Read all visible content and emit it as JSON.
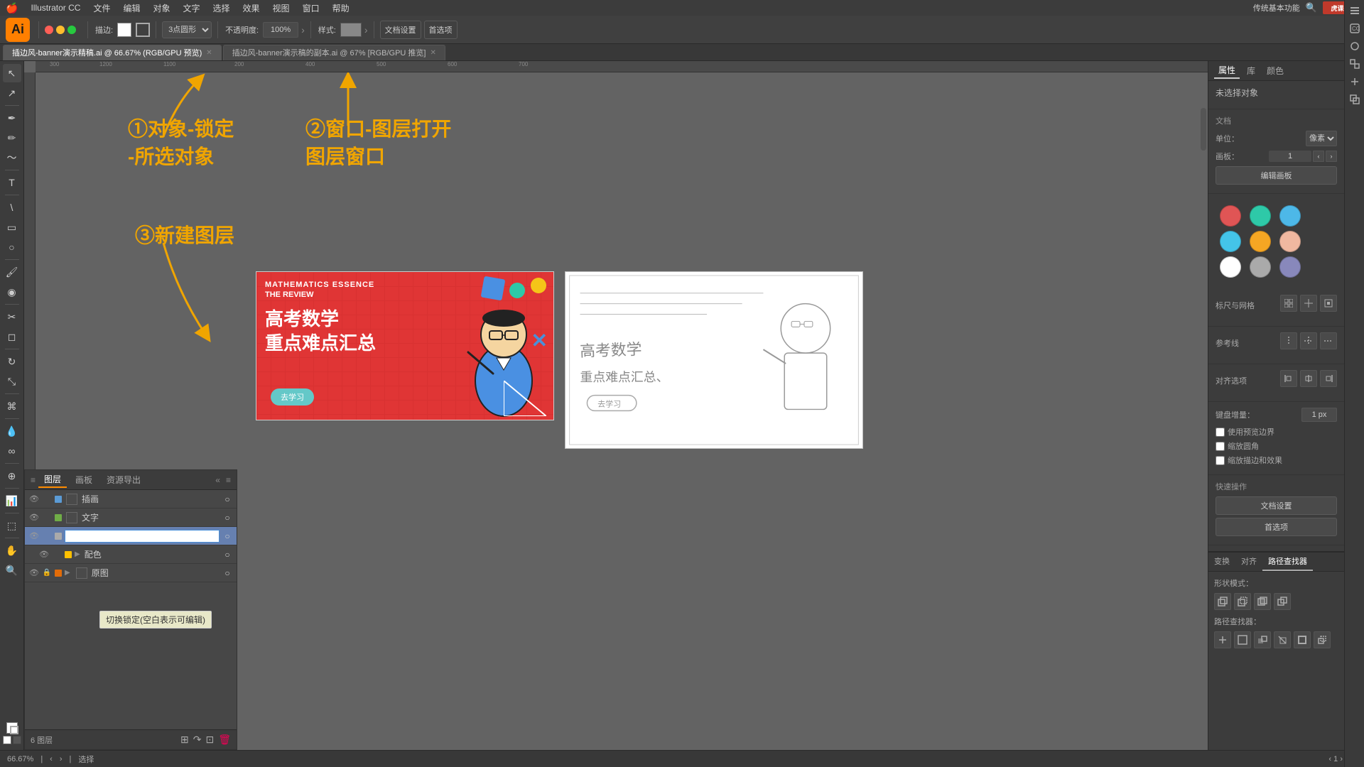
{
  "app": {
    "name": "Illustrator CC",
    "logo": "Ai",
    "version": "CC"
  },
  "menubar": {
    "apple": "🍎",
    "items": [
      "Illustrator CC",
      "文件",
      "编辑",
      "对象",
      "文字",
      "选择",
      "效果",
      "视图",
      "窗口",
      "帮助"
    ]
  },
  "toolbar": {
    "stroke_label": "描边:",
    "stroke_value": "",
    "shape_label": "3点圆形",
    "opacity_label": "不透明度:",
    "opacity_value": "100%",
    "style_label": "样式:",
    "doc_settings": "文档设置",
    "preferences": "首选项",
    "function_label": "传统基本功能"
  },
  "tabs": [
    {
      "name": "插边风-banner演示精稿.ai",
      "mode": "66.67%",
      "color": "RGB/GPU",
      "active": true
    },
    {
      "name": "插边风-banner演示稿的副本.ai",
      "mode": "67%",
      "color": "RGB/GPU 预览",
      "active": false
    }
  ],
  "annotations": {
    "step1": "①对象-锁定\n-所选对象",
    "step2": "②窗口-图层打开\n图层窗口",
    "step3": "③新建图层"
  },
  "layers_panel": {
    "title": "图层",
    "tabs": [
      "图层",
      "画板",
      "资源导出"
    ],
    "layers": [
      {
        "name": "插画",
        "color": "#5b9bd5",
        "visible": true,
        "locked": false,
        "expanded": false
      },
      {
        "name": "文字",
        "color": "#70ad47",
        "visible": true,
        "locked": false,
        "expanded": false
      },
      {
        "name": "",
        "color": "#aaaaaa",
        "visible": true,
        "locked": false,
        "expanded": false,
        "editing": true
      },
      {
        "name": "配色",
        "color": "#ffc000",
        "visible": true,
        "locked": false,
        "expanded": true,
        "indent": true
      },
      {
        "name": "原图",
        "color": "#e36c09",
        "visible": true,
        "locked": true,
        "expanded": false
      }
    ],
    "footer": "6 图层",
    "tooltip": "切换锁定(空白表示可编辑)"
  },
  "right_panel": {
    "tabs": [
      "属性",
      "库",
      "颜色"
    ],
    "active_tab": "属性",
    "selection": "未选择对象",
    "doc_section": "文档",
    "unit_label": "单位：",
    "unit_value": "像素",
    "artboard_label": "画板：",
    "artboard_value": "1",
    "edit_artboard_btn": "编辑画板",
    "swatches": [
      {
        "color": "#e05555",
        "name": "red"
      },
      {
        "color": "#2ec9a8",
        "name": "teal"
      },
      {
        "color": "#4db8e8",
        "name": "light-blue"
      },
      {
        "color": "#44c4e8",
        "name": "cyan"
      },
      {
        "color": "#f5a623",
        "name": "orange"
      },
      {
        "color": "#f0b8a0",
        "name": "salmon"
      },
      {
        "color": "#ffffff",
        "name": "white"
      },
      {
        "color": "#aaaaaa",
        "name": "gray"
      },
      {
        "color": "#8888bb",
        "name": "lavender"
      }
    ],
    "snap_label": "标尺与网格",
    "guides_label": "参考线",
    "align_label": "对齐选项",
    "transform_label": "首选项",
    "keyboard_increment_label": "键盘增量：",
    "keyboard_increment_value": "1 px",
    "use_preview_bounds": "使用预览边界",
    "use_rounded_corners": "缩放圆角",
    "scale_effects": "缩放描边和效果",
    "quick_actions_label": "快速操作",
    "doc_settings_btn": "文档设置",
    "preferences_btn": "首选项",
    "bottom_tabs": [
      "变换",
      "对齐",
      "路径查找器"
    ],
    "active_bottom_tab": "路径查找器",
    "shape_mode_label": "形状模式：",
    "pathfinder_label": "路径查找器："
  },
  "statusbar": {
    "zoom": "66.67%",
    "tool": "选择",
    "artboard_indicator": "1"
  },
  "math_banner": {
    "subtitle1": "MATHEMATICS ESSENCE",
    "subtitle2": "THE REVIEW",
    "main_text1": "高考数学",
    "main_text2": "重点难点汇总",
    "cta_btn": "去学习"
  },
  "icons": {
    "tools": [
      "↖",
      "✦",
      "✏",
      "▭",
      "✂",
      "⊙",
      "✒",
      "T",
      "⬚",
      "☞",
      "⚲",
      "⊕",
      "◉",
      "⬡",
      "⟲"
    ],
    "right_col": [
      "📋",
      "🔲",
      "⚙",
      "🔗",
      "📐",
      "🎨"
    ]
  }
}
